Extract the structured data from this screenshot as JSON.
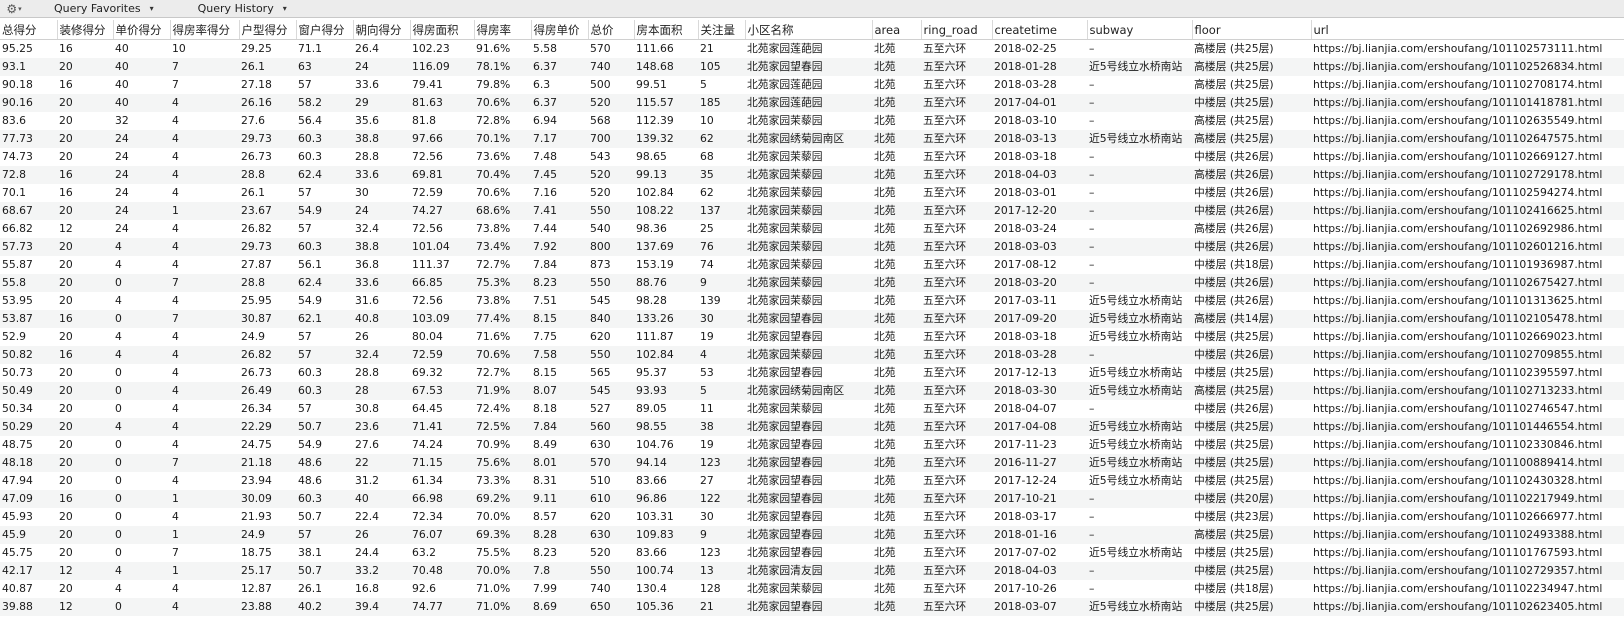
{
  "toolbar": {
    "gear_icon": "⚙",
    "gear_caret": "▾",
    "favorites_label": "Query Favorites",
    "history_label": "Query History",
    "caret": "▾"
  },
  "table": {
    "columns": [
      "总得分",
      "装修得分",
      "单价得分",
      "得房率得分",
      "户型得分",
      "窗户得分",
      "朝向得分",
      "得房面积",
      "得房率",
      "得房单价",
      "总价",
      "房本面积",
      "关注量",
      "小区名称",
      "area",
      "ring_road",
      "createtime",
      "subway",
      "floor",
      "url"
    ],
    "rows": [
      [
        "95.25",
        "16",
        "40",
        "10",
        "29.25",
        "71.1",
        "26.4",
        "102.23",
        "91.6%",
        "5.58",
        "570",
        "111.66",
        "21",
        "北苑家园莲葩园",
        "北苑",
        "五至六环",
        "2018-02-25",
        "–",
        "高楼层 (共25层)",
        "https://bj.lianjia.com/ershoufang/101102573111.html"
      ],
      [
        "93.1",
        "20",
        "40",
        "7",
        "26.1",
        "63",
        "24",
        "116.09",
        "78.1%",
        "6.37",
        "740",
        "148.68",
        "105",
        "北苑家园望春园",
        "北苑",
        "五至六环",
        "2018-01-28",
        "近5号线立水桥南站",
        "高楼层 (共25层)",
        "https://bj.lianjia.com/ershoufang/101102526834.html"
      ],
      [
        "90.18",
        "16",
        "40",
        "7",
        "27.18",
        "57",
        "33.6",
        "79.41",
        "79.8%",
        "6.3",
        "500",
        "99.51",
        "5",
        "北苑家园莲葩园",
        "北苑",
        "五至六环",
        "2018-03-28",
        "–",
        "高楼层 (共25层)",
        "https://bj.lianjia.com/ershoufang/101102708174.html"
      ],
      [
        "90.16",
        "20",
        "40",
        "4",
        "26.16",
        "58.2",
        "29",
        "81.63",
        "70.6%",
        "6.37",
        "520",
        "115.57",
        "185",
        "北苑家园莲葩园",
        "北苑",
        "五至六环",
        "2017-04-01",
        "–",
        "中楼层 (共25层)",
        "https://bj.lianjia.com/ershoufang/101101418781.html"
      ],
      [
        "83.6",
        "20",
        "32",
        "4",
        "27.6",
        "56.4",
        "35.6",
        "81.8",
        "72.8%",
        "6.94",
        "568",
        "112.39",
        "10",
        "北苑家园茉藜园",
        "北苑",
        "五至六环",
        "2018-03-10",
        "–",
        "高楼层 (共25层)",
        "https://bj.lianjia.com/ershoufang/101102635549.html"
      ],
      [
        "77.73",
        "20",
        "24",
        "4",
        "29.73",
        "60.3",
        "38.8",
        "97.66",
        "70.1%",
        "7.17",
        "700",
        "139.32",
        "62",
        "北苑家园绣菊园南区",
        "北苑",
        "五至六环",
        "2018-03-13",
        "近5号线立水桥南站",
        "高楼层 (共25层)",
        "https://bj.lianjia.com/ershoufang/101102647575.html"
      ],
      [
        "74.73",
        "20",
        "24",
        "4",
        "26.73",
        "60.3",
        "28.8",
        "72.56",
        "73.6%",
        "7.48",
        "543",
        "98.65",
        "68",
        "北苑家园茉藜园",
        "北苑",
        "五至六环",
        "2018-03-18",
        "–",
        "中楼层 (共26层)",
        "https://bj.lianjia.com/ershoufang/101102669127.html"
      ],
      [
        "72.8",
        "16",
        "24",
        "4",
        "28.8",
        "62.4",
        "33.6",
        "69.81",
        "70.4%",
        "7.45",
        "520",
        "99.13",
        "35",
        "北苑家园茉藜园",
        "北苑",
        "五至六环",
        "2018-04-03",
        "–",
        "高楼层 (共26层)",
        "https://bj.lianjia.com/ershoufang/101102729178.html"
      ],
      [
        "70.1",
        "16",
        "24",
        "4",
        "26.1",
        "57",
        "30",
        "72.59",
        "70.6%",
        "7.16",
        "520",
        "102.84",
        "62",
        "北苑家园茉藜园",
        "北苑",
        "五至六环",
        "2018-03-01",
        "–",
        "中楼层 (共26层)",
        "https://bj.lianjia.com/ershoufang/101102594274.html"
      ],
      [
        "68.67",
        "20",
        "24",
        "1",
        "23.67",
        "54.9",
        "24",
        "74.27",
        "68.6%",
        "7.41",
        "550",
        "108.22",
        "137",
        "北苑家园茉藜园",
        "北苑",
        "五至六环",
        "2017-12-20",
        "–",
        "中楼层 (共26层)",
        "https://bj.lianjia.com/ershoufang/101102416625.html"
      ],
      [
        "66.82",
        "12",
        "24",
        "4",
        "26.82",
        "57",
        "32.4",
        "72.56",
        "73.8%",
        "7.44",
        "540",
        "98.36",
        "25",
        "北苑家园茉藜园",
        "北苑",
        "五至六环",
        "2018-03-24",
        "–",
        "高楼层 (共26层)",
        "https://bj.lianjia.com/ershoufang/101102692986.html"
      ],
      [
        "57.73",
        "20",
        "4",
        "4",
        "29.73",
        "60.3",
        "38.8",
        "101.04",
        "73.4%",
        "7.92",
        "800",
        "137.69",
        "76",
        "北苑家园茉藜园",
        "北苑",
        "五至六环",
        "2018-03-03",
        "–",
        "中楼层 (共26层)",
        "https://bj.lianjia.com/ershoufang/101102601216.html"
      ],
      [
        "55.87",
        "20",
        "4",
        "4",
        "27.87",
        "56.1",
        "36.8",
        "111.37",
        "72.7%",
        "7.84",
        "873",
        "153.19",
        "74",
        "北苑家园茉藜园",
        "北苑",
        "五至六环",
        "2017-08-12",
        "–",
        "中楼层 (共18层)",
        "https://bj.lianjia.com/ershoufang/101101936987.html"
      ],
      [
        "55.8",
        "20",
        "0",
        "7",
        "28.8",
        "62.4",
        "33.6",
        "66.85",
        "75.3%",
        "8.23",
        "550",
        "88.76",
        "9",
        "北苑家园茉藜园",
        "北苑",
        "五至六环",
        "2018-03-20",
        "–",
        "中楼层 (共26层)",
        "https://bj.lianjia.com/ershoufang/101102675427.html"
      ],
      [
        "53.95",
        "20",
        "4",
        "4",
        "25.95",
        "54.9",
        "31.6",
        "72.56",
        "73.8%",
        "7.51",
        "545",
        "98.28",
        "139",
        "北苑家园茉藜园",
        "北苑",
        "五至六环",
        "2017-03-11",
        "近5号线立水桥南站",
        "中楼层 (共26层)",
        "https://bj.lianjia.com/ershoufang/101101313625.html"
      ],
      [
        "53.87",
        "16",
        "0",
        "7",
        "30.87",
        "62.1",
        "40.8",
        "103.09",
        "77.4%",
        "8.15",
        "840",
        "133.26",
        "30",
        "北苑家园望春园",
        "北苑",
        "五至六环",
        "2017-09-20",
        "近5号线立水桥南站",
        "高楼层 (共14层)",
        "https://bj.lianjia.com/ershoufang/101102105478.html"
      ],
      [
        "52.9",
        "20",
        "4",
        "4",
        "24.9",
        "57",
        "26",
        "80.04",
        "71.6%",
        "7.75",
        "620",
        "111.87",
        "19",
        "北苑家园望春园",
        "北苑",
        "五至六环",
        "2018-03-18",
        "近5号线立水桥南站",
        "中楼层 (共25层)",
        "https://bj.lianjia.com/ershoufang/101102669023.html"
      ],
      [
        "50.82",
        "16",
        "4",
        "4",
        "26.82",
        "57",
        "32.4",
        "72.59",
        "70.6%",
        "7.58",
        "550",
        "102.84",
        "4",
        "北苑家园茉藜园",
        "北苑",
        "五至六环",
        "2018-03-28",
        "–",
        "中楼层 (共26层)",
        "https://bj.lianjia.com/ershoufang/101102709855.html"
      ],
      [
        "50.73",
        "20",
        "0",
        "4",
        "26.73",
        "60.3",
        "28.8",
        "69.32",
        "72.7%",
        "8.15",
        "565",
        "95.37",
        "53",
        "北苑家园望春园",
        "北苑",
        "五至六环",
        "2017-12-13",
        "近5号线立水桥南站",
        "中楼层 (共25层)",
        "https://bj.lianjia.com/ershoufang/101102395597.html"
      ],
      [
        "50.49",
        "20",
        "0",
        "4",
        "26.49",
        "60.3",
        "28",
        "67.53",
        "71.9%",
        "8.07",
        "545",
        "93.93",
        "5",
        "北苑家园绣菊园南区",
        "北苑",
        "五至六环",
        "2018-03-30",
        "近5号线立水桥南站",
        "高楼层 (共25层)",
        "https://bj.lianjia.com/ershoufang/101102713233.html"
      ],
      [
        "50.34",
        "20",
        "0",
        "4",
        "26.34",
        "57",
        "30.8",
        "64.45",
        "72.4%",
        "8.18",
        "527",
        "89.05",
        "11",
        "北苑家园茉藜园",
        "北苑",
        "五至六环",
        "2018-04-07",
        "–",
        "中楼层 (共26层)",
        "https://bj.lianjia.com/ershoufang/101102746547.html"
      ],
      [
        "50.29",
        "20",
        "4",
        "4",
        "22.29",
        "50.7",
        "23.6",
        "71.41",
        "72.5%",
        "7.84",
        "560",
        "98.55",
        "38",
        "北苑家园望春园",
        "北苑",
        "五至六环",
        "2017-04-08",
        "近5号线立水桥南站",
        "中楼层 (共25层)",
        "https://bj.lianjia.com/ershoufang/101101446554.html"
      ],
      [
        "48.75",
        "20",
        "0",
        "4",
        "24.75",
        "54.9",
        "27.6",
        "74.24",
        "70.9%",
        "8.49",
        "630",
        "104.76",
        "19",
        "北苑家园望春园",
        "北苑",
        "五至六环",
        "2017-11-23",
        "近5号线立水桥南站",
        "中楼层 (共25层)",
        "https://bj.lianjia.com/ershoufang/101102330846.html"
      ],
      [
        "48.18",
        "20",
        "0",
        "7",
        "21.18",
        "48.6",
        "22",
        "71.15",
        "75.6%",
        "8.01",
        "570",
        "94.14",
        "123",
        "北苑家园望春园",
        "北苑",
        "五至六环",
        "2016-11-27",
        "近5号线立水桥南站",
        "中楼层 (共25层)",
        "https://bj.lianjia.com/ershoufang/101100889414.html"
      ],
      [
        "47.94",
        "20",
        "0",
        "4",
        "23.94",
        "48.6",
        "31.2",
        "61.34",
        "73.3%",
        "8.31",
        "510",
        "83.66",
        "27",
        "北苑家园望春园",
        "北苑",
        "五至六环",
        "2017-12-24",
        "近5号线立水桥南站",
        "中楼层 (共25层)",
        "https://bj.lianjia.com/ershoufang/101102430328.html"
      ],
      [
        "47.09",
        "16",
        "0",
        "1",
        "30.09",
        "60.3",
        "40",
        "66.98",
        "69.2%",
        "9.11",
        "610",
        "96.86",
        "122",
        "北苑家园望春园",
        "北苑",
        "五至六环",
        "2017-10-21",
        "–",
        "中楼层 (共20层)",
        "https://bj.lianjia.com/ershoufang/101102217949.html"
      ],
      [
        "45.93",
        "20",
        "0",
        "4",
        "21.93",
        "50.7",
        "22.4",
        "72.34",
        "70.0%",
        "8.57",
        "620",
        "103.31",
        "30",
        "北苑家园望春园",
        "北苑",
        "五至六环",
        "2018-03-17",
        "–",
        "中楼层 (共23层)",
        "https://bj.lianjia.com/ershoufang/101102666977.html"
      ],
      [
        "45.9",
        "20",
        "0",
        "1",
        "24.9",
        "57",
        "26",
        "76.07",
        "69.3%",
        "8.28",
        "630",
        "109.83",
        "9",
        "北苑家园望春园",
        "北苑",
        "五至六环",
        "2018-01-16",
        "–",
        "高楼层 (共25层)",
        "https://bj.lianjia.com/ershoufang/101102493388.html"
      ],
      [
        "45.75",
        "20",
        "0",
        "7",
        "18.75",
        "38.1",
        "24.4",
        "63.2",
        "75.5%",
        "8.23",
        "520",
        "83.66",
        "123",
        "北苑家园望春园",
        "北苑",
        "五至六环",
        "2017-07-02",
        "近5号线立水桥南站",
        "中楼层 (共25层)",
        "https://bj.lianjia.com/ershoufang/101101767593.html"
      ],
      [
        "42.17",
        "12",
        "4",
        "1",
        "25.17",
        "50.7",
        "33.2",
        "70.48",
        "70.0%",
        "7.8",
        "550",
        "100.74",
        "13",
        "北苑家园清友园",
        "北苑",
        "五至六环",
        "2018-04-03",
        "–",
        "中楼层 (共25层)",
        "https://bj.lianjia.com/ershoufang/101102729357.html"
      ],
      [
        "40.87",
        "20",
        "4",
        "4",
        "12.87",
        "26.1",
        "16.8",
        "92.6",
        "71.0%",
        "7.99",
        "740",
        "130.4",
        "128",
        "北苑家园茉藜园",
        "北苑",
        "五至六环",
        "2017-10-26",
        "–",
        "中楼层 (共18层)",
        "https://bj.lianjia.com/ershoufang/101102234947.html"
      ],
      [
        "39.88",
        "12",
        "0",
        "4",
        "23.88",
        "40.2",
        "39.4",
        "74.77",
        "71.0%",
        "8.69",
        "650",
        "105.36",
        "21",
        "北苑家园望春园",
        "北苑",
        "五至六环",
        "2018-03-07",
        "近5号线立水桥南站",
        "中楼层 (共25层)",
        "https://bj.lianjia.com/ershoufang/101102623405.html"
      ]
    ]
  }
}
